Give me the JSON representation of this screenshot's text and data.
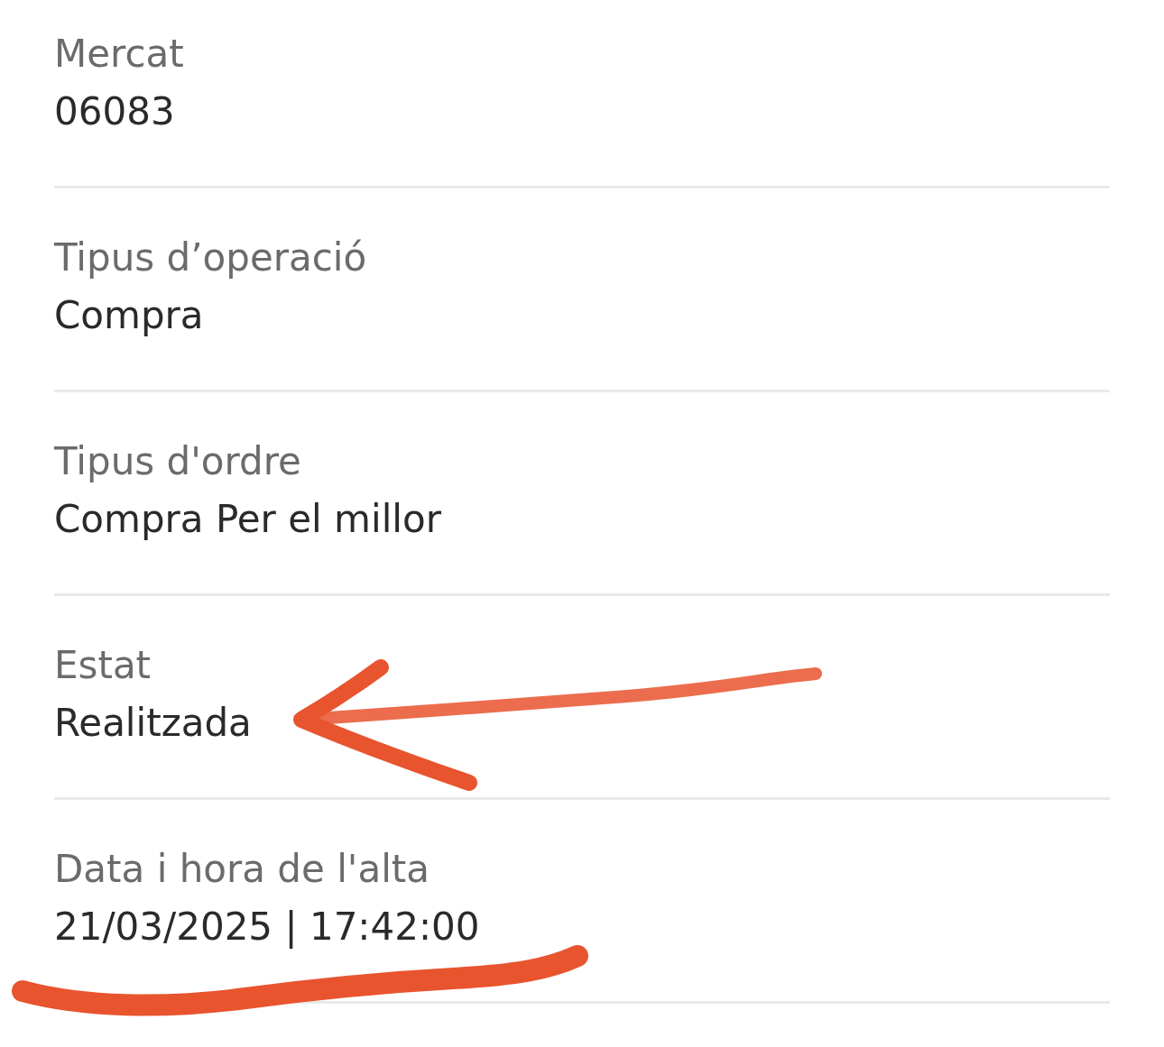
{
  "fields": [
    {
      "label": "Mercat",
      "value": "06083"
    },
    {
      "label": "Tipus d’operació",
      "value": "Compra"
    },
    {
      "label": "Tipus d'ordre",
      "value": "Compra Per el millor"
    },
    {
      "label": "Estat",
      "value": "Realitzada",
      "annotation": {
        "kind": "arrow"
      }
    },
    {
      "label": "Data i hora de l'alta",
      "value": "21/03/2025 | 17:42:00",
      "annotation": {
        "kind": "underline"
      }
    }
  ]
}
